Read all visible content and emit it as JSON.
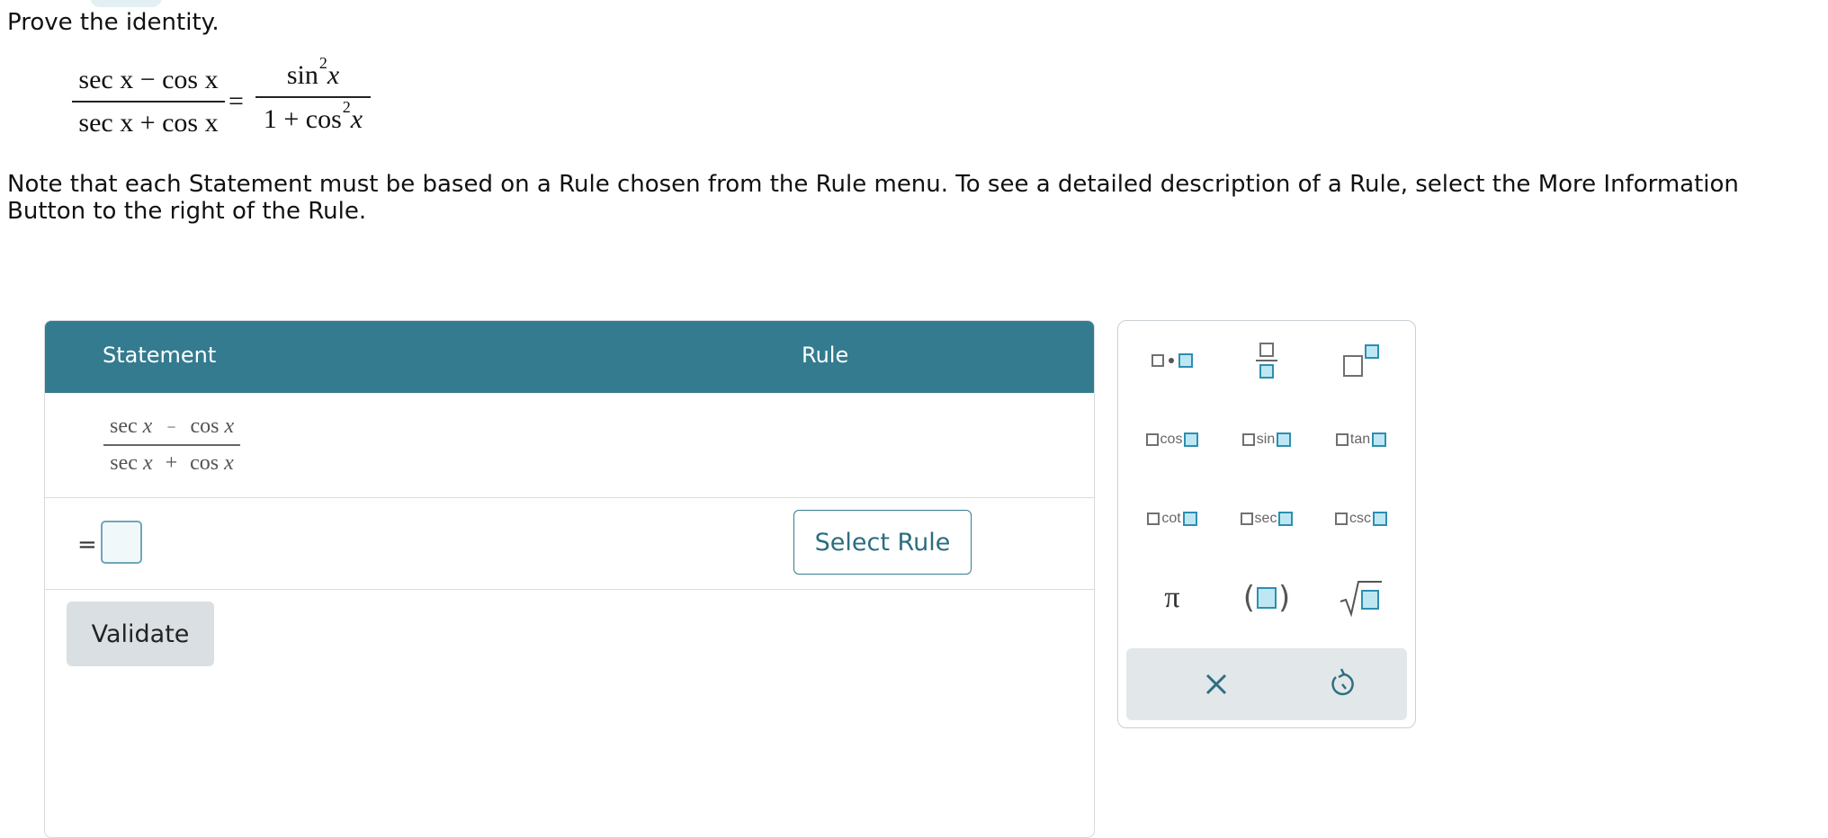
{
  "prompt": "Prove the identity.",
  "identity": {
    "lhs_num": "sec x − cos x",
    "lhs_den": "sec x + cos x",
    "equals": "=",
    "rhs_num_fn": "sin",
    "rhs_num_exp": "2",
    "rhs_num_var": "x",
    "rhs_den_pre": "1 + cos",
    "rhs_den_exp": "2",
    "rhs_den_var": "x"
  },
  "note": "Note that each Statement must be based on a Rule chosen from the Rule menu. To see a detailed description of a Rule, select the More Information Button to the right of the Rule.",
  "table": {
    "header_statement": "Statement",
    "header_rule": "Rule",
    "given_num_a": "sec",
    "given_num_op": "−",
    "given_num_b": "cos",
    "given_den_a": "sec",
    "given_den_op": "+",
    "given_den_b": "cos",
    "var": "x",
    "equals": "=",
    "select_rule_label": "Select Rule",
    "validate_label": "Validate"
  },
  "palette": {
    "cos": "cos",
    "sin": "sin",
    "tan": "tan",
    "cot": "cot",
    "sec": "sec",
    "csc": "csc",
    "pi": "π",
    "icons": [
      "multiply-dot-icon",
      "fraction-icon",
      "exponent-icon",
      "paren-icon",
      "sqrt-icon",
      "close-icon",
      "undo-icon"
    ],
    "accent_color": "#2c8fb0"
  },
  "colors": {
    "header_bg": "#347b8f",
    "button_outline": "#357d90",
    "validate_bg": "#d9dfe2"
  }
}
